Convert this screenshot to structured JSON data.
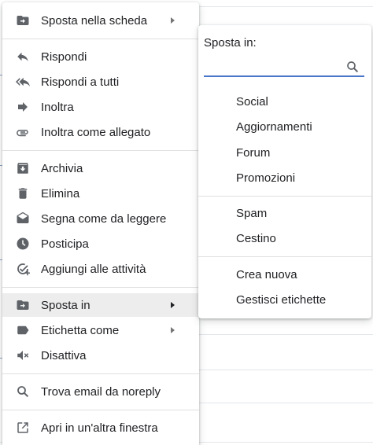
{
  "context_menu": {
    "items": [
      {
        "label": "Sposta nella scheda",
        "icon": "move-to-tab-icon",
        "has_submenu": true
      },
      {
        "label": "Rispondi",
        "icon": "reply-icon"
      },
      {
        "label": "Rispondi a tutti",
        "icon": "reply-all-icon"
      },
      {
        "label": "Inoltra",
        "icon": "forward-icon"
      },
      {
        "label": "Inoltra come allegato",
        "icon": "attachment-icon"
      },
      {
        "label": "Archivia",
        "icon": "archive-icon"
      },
      {
        "label": "Elimina",
        "icon": "trash-icon"
      },
      {
        "label": "Segna come da leggere",
        "icon": "mark-unread-icon"
      },
      {
        "label": "Posticipa",
        "icon": "snooze-clock-icon"
      },
      {
        "label": "Aggiungi alle attività",
        "icon": "add-task-icon"
      },
      {
        "label": "Sposta in",
        "icon": "move-to-icon",
        "has_submenu": true,
        "active": true
      },
      {
        "label": "Etichetta come",
        "icon": "label-icon",
        "has_submenu": true
      },
      {
        "label": "Disattiva",
        "icon": "mute-icon"
      },
      {
        "label": "Trova email da noreply",
        "icon": "search-icon"
      },
      {
        "label": "Apri in un'altra finestra",
        "icon": "open-in-new-icon"
      }
    ]
  },
  "submenu": {
    "title": "Sposta in:",
    "search": {
      "value": "",
      "placeholder": ""
    },
    "items": [
      {
        "label": "Social"
      },
      {
        "label": "Aggiornamenti"
      },
      {
        "label": "Forum"
      },
      {
        "label": "Promozioni"
      },
      {
        "label": "Spam"
      },
      {
        "label": "Cestino"
      },
      {
        "label": "Crea nuova"
      },
      {
        "label": "Gestisci etichette"
      }
    ]
  },
  "colors": {
    "icon": "#5f6368",
    "active_background": "#ededed",
    "search_underline": "#4a76c9",
    "divider": "#e0e0e0"
  }
}
